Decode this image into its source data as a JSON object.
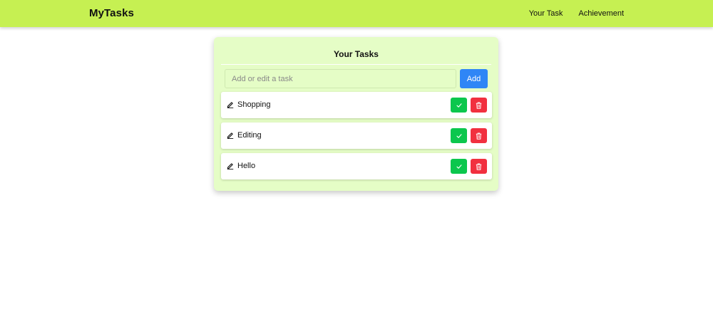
{
  "app": {
    "brand": "MyTasks"
  },
  "nav": {
    "links": [
      "Your Task",
      "Achievement"
    ]
  },
  "colors": {
    "navbar": "#c6f052",
    "card": "#e5fdc6",
    "add_button": "#2f86f6",
    "done_button": "#0bc74d",
    "delete_button": "#f1303f"
  },
  "panel": {
    "title": "Your Tasks",
    "input": {
      "placeholder": "Add or edit a task",
      "value": ""
    },
    "add_label": "Add"
  },
  "tasks": [
    {
      "text": "Shopping",
      "icons": [
        "pencil-icon",
        "check-icon",
        "trash-icon"
      ]
    },
    {
      "text": "Editing",
      "icons": [
        "pencil-icon",
        "check-icon",
        "trash-icon"
      ]
    },
    {
      "text": "Hello",
      "icons": [
        "pencil-icon",
        "check-icon",
        "trash-icon"
      ]
    }
  ]
}
